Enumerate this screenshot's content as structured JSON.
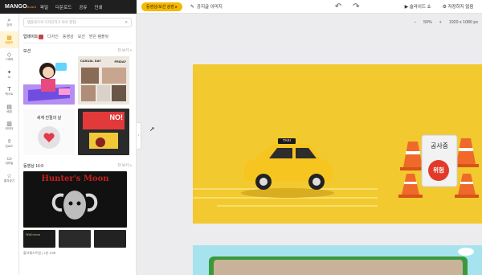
{
  "topbar": {
    "logo_main": "MANGO",
    "logo_sub": "board",
    "menu": [
      "파일",
      "다운로드",
      "공유",
      "인쇄"
    ],
    "promo_label": "동영상/모션 광장 ▸",
    "share_label": "공지글 이미지",
    "slides_label": "슬라이드 쇼",
    "save_label": "저장하지 않음"
  },
  "rail": [
    {
      "icon": "home-icon",
      "glyph": "⌂",
      "label": "검색"
    },
    {
      "icon": "template-icon",
      "glyph": "▦",
      "label": "템플릿"
    },
    {
      "icon": "shapes-icon",
      "glyph": "◇",
      "label": "그래픽"
    },
    {
      "icon": "ai-icon",
      "glyph": "✦",
      "label": "AI"
    },
    {
      "icon": "text-icon",
      "glyph": "T",
      "label": "텍스트"
    },
    {
      "icon": "background-icon",
      "glyph": "▤",
      "label": "배경"
    },
    {
      "icon": "chart-icon",
      "glyph": "▥",
      "label": "데이터"
    },
    {
      "icon": "upload-icon",
      "glyph": "⇪",
      "label": "업로드"
    },
    {
      "icon": "folder-icon",
      "glyph": "▭",
      "label": "내파일"
    },
    {
      "icon": "star-icon",
      "glyph": "☆",
      "label": "즐겨찾기"
    }
  ],
  "panel": {
    "search_placeholder": "템플릿으로 디자인하고 바로 편집!",
    "tabs": [
      "업데이트",
      "디자인",
      "동영상",
      "모션",
      "받은 템플릿"
    ],
    "new_badge": "N",
    "section1_title": "모션",
    "section1_more": "더 보기 >",
    "section2_title": "동영상 16:9",
    "section2_more": "더 보기 >",
    "thumb_texts": {
      "casual_day": "CASUAL DAY",
      "friday": "FRIDAY",
      "world_kind": "세계 친절의 날",
      "no_text": "NO!",
      "hunter_moon": "Hunter's Moon",
      "welcome": "Welcome",
      "bottom_label": "할러웨스트원 | 1분 10초"
    }
  },
  "canvas": {
    "zoom": "50%",
    "size": "1920 x 1080 px",
    "taxi_sign": "TAXI",
    "construction": "공사중",
    "danger": "위험"
  },
  "colors": {
    "accent": "#f5b800",
    "canvas_bg": "#f2c92e",
    "taxi": "#f7c520"
  }
}
